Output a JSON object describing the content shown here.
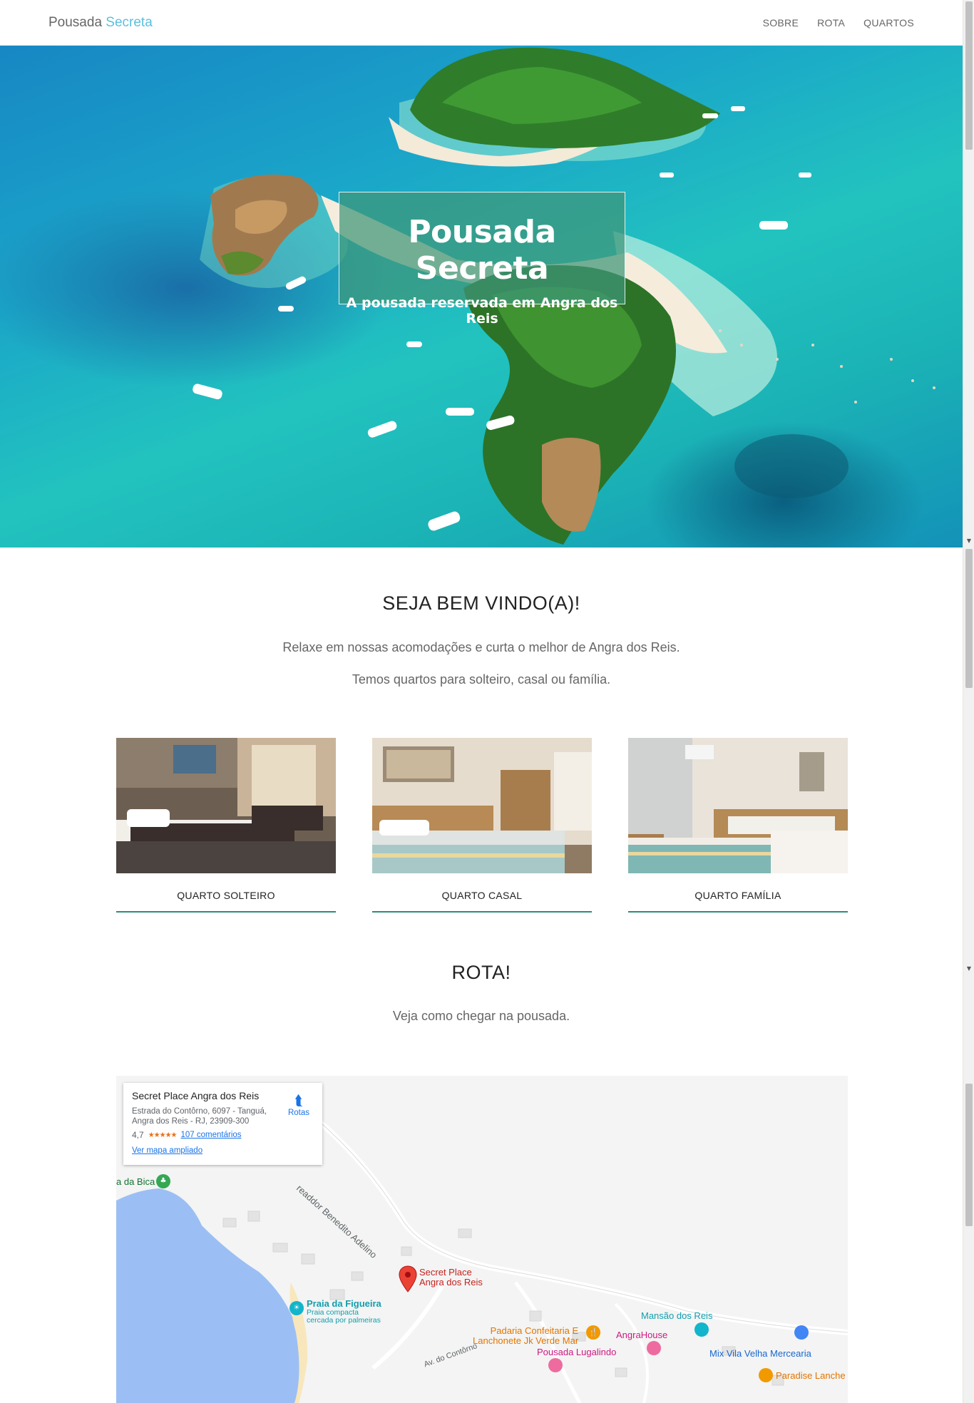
{
  "nav": {
    "brand_main": "Pousada",
    "brand_accent": "Secreta",
    "links": [
      "SOBRE",
      "ROTA",
      "QUARTOS"
    ]
  },
  "hero": {
    "title": "Pousada Secreta",
    "subtitle": "A pousada reservada em Angra dos Reis"
  },
  "welcome": {
    "title": "SEJA BEM VINDO(A)!",
    "line1": "Relaxe em nossas acomodações e curta o melhor de Angra dos Reis.",
    "line2": "Temos quartos para solteiro, casal ou família."
  },
  "rooms": [
    {
      "label": "QUARTO SOLTEIRO"
    },
    {
      "label": "QUARTO CASAL"
    },
    {
      "label": "QUARTO FAMÍLIA"
    }
  ],
  "route": {
    "title": "ROTA!",
    "text": "Veja como chegar na pousada."
  },
  "map": {
    "card": {
      "title": "Secret Place Angra dos Reis",
      "address": "Estrada do Contôrno, 6097 - Tanguá, Angra dos Reis - RJ, 23909-300",
      "rating": "4,7",
      "stars": "★★★★★",
      "reviews": "107 comentários",
      "directions": "Rotas",
      "bigger_map": "Ver mapa ampliado"
    },
    "labels": {
      "bica": "a da Bica",
      "road1": "readdor Benedito Adelino",
      "secret_place_1": "Secret Place",
      "secret_place_2": "Angra dos Reis",
      "figueira": "Praia da Figueira",
      "figueira_desc_1": "Praia compacta",
      "figueira_desc_2": "cercada por palmeiras",
      "mansao": "Mansão dos Reis",
      "padaria_1": "Padaria Confeitaria E",
      "padaria_2": "Lanchonete Jk Verde Mar",
      "angrahouse": "AngraHouse",
      "lugalindo": "Pousada Lugalindo",
      "mercearia": "Mix Vila Velha Mercearia",
      "paradise": "Paradise Lanche",
      "road2": "Av. do Contôrno"
    }
  },
  "colors": {
    "accent": "#5bc0de",
    "room_underline": "#2e8b7a",
    "hero_box": "#3e9678",
    "map_link": "#1a73e8"
  }
}
